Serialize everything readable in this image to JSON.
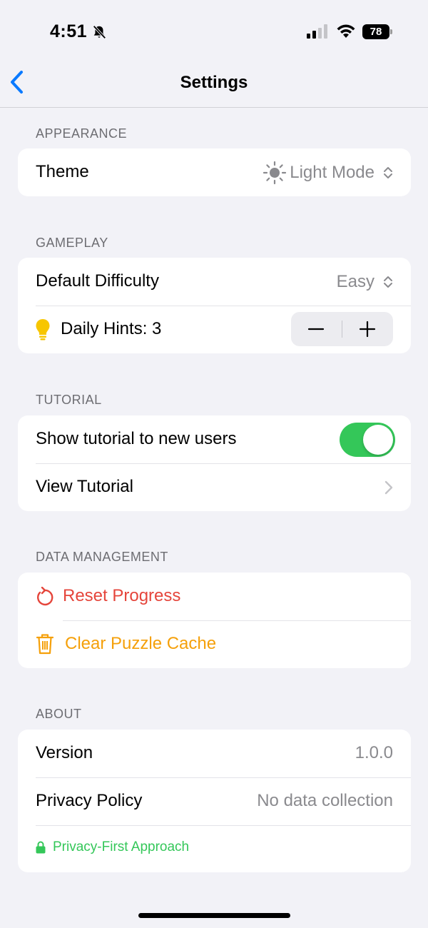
{
  "status_bar": {
    "time": "4:51",
    "battery": "78"
  },
  "nav": {
    "title": "Settings"
  },
  "sections": {
    "appearance": {
      "header": "APPEARANCE",
      "theme_label": "Theme",
      "theme_value": "Light Mode"
    },
    "gameplay": {
      "header": "GAMEPLAY",
      "difficulty_label": "Default Difficulty",
      "difficulty_value": "Easy",
      "hints_label": "Daily Hints: 3"
    },
    "tutorial": {
      "header": "TUTORIAL",
      "show_tutorial_label": "Show tutorial to new users",
      "show_tutorial_on": true,
      "view_tutorial_label": "View Tutorial"
    },
    "data_management": {
      "header": "DATA MANAGEMENT",
      "reset_label": "Reset Progress",
      "clear_cache_label": "Clear Puzzle Cache"
    },
    "about": {
      "header": "ABOUT",
      "version_label": "Version",
      "version_value": "1.0.0",
      "privacy_label": "Privacy Policy",
      "privacy_value": "No data collection",
      "privacy_badge": "Privacy-First Approach"
    }
  },
  "colors": {
    "background": "#f2f2f7",
    "accent_blue": "#0a7aff",
    "toggle_green": "#34c759",
    "destructive_red": "#e5453b",
    "warning_orange": "#f5a00a",
    "hint_yellow": "#f7c600",
    "secondary_text": "#8a8a8e"
  }
}
